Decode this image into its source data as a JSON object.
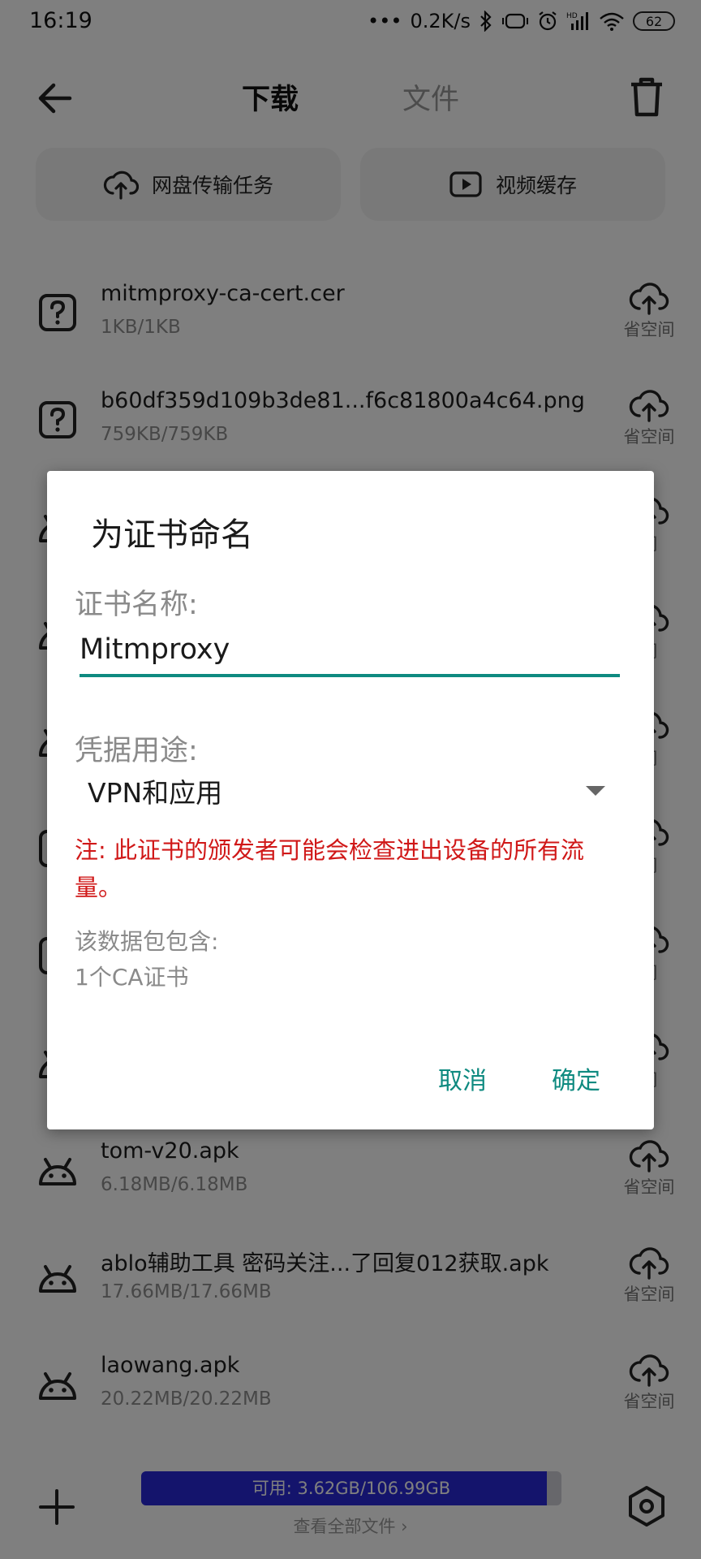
{
  "status_bar": {
    "time": "16:19",
    "net_speed": "0.2K/s",
    "battery": "62",
    "icons": [
      "dots-icon",
      "bluetooth-icon",
      "vibrate-icon",
      "alarm-icon",
      "signal-icon",
      "wifi-icon",
      "battery-icon"
    ]
  },
  "header": {
    "tabs": [
      {
        "label": "下载",
        "active": true
      },
      {
        "label": "文件",
        "active": false
      }
    ]
  },
  "cards": [
    {
      "label": "网盘传输任务",
      "icon": "cloud-transfer-icon"
    },
    {
      "label": "视频缓存",
      "icon": "video-play-icon"
    }
  ],
  "downloads": [
    {
      "name": "mitmproxy-ca-cert.cer",
      "size": "1KB/1KB",
      "icon": "unknown-file-icon",
      "action": "省空间"
    },
    {
      "name": "b60df359d109b3de81...f6c81800a4c64.png",
      "size": "759KB/759KB",
      "icon": "unknown-file-icon",
      "action": "省空间"
    },
    {
      "name": "",
      "size": "",
      "icon": "android-icon",
      "action": "间"
    },
    {
      "name": "",
      "size": "",
      "icon": "android-icon",
      "action": "间"
    },
    {
      "name": "",
      "size": "",
      "icon": "android-icon",
      "action": "间"
    },
    {
      "name": "",
      "size": "",
      "icon": "unknown-file-icon",
      "action": "间"
    },
    {
      "name": "",
      "size": "",
      "icon": "unknown-file-icon",
      "action": "间"
    },
    {
      "name": "",
      "size": "",
      "icon": "android-icon",
      "action": "间"
    },
    {
      "name": "tom-v20.apk",
      "size": "6.18MB/6.18MB",
      "icon": "android-icon",
      "action": "省空间"
    },
    {
      "name": "ablo辅助工具 密码关注...了回复012获取.apk",
      "size": "17.66MB/17.66MB",
      "icon": "android-icon",
      "action": "省空间"
    },
    {
      "name": "laowang.apk",
      "size": "20.22MB/20.22MB",
      "icon": "android-icon",
      "action": "省空间"
    }
  ],
  "bottom_bar": {
    "storage_text": "可用: 3.62GB/106.99GB",
    "storage_used_fraction": 0.966,
    "view_all": "查看全部文件 ›"
  },
  "dialog": {
    "title": "为证书命名",
    "name_label": "证书名称:",
    "name_value": "Mitmproxy",
    "usage_label": "凭据用途:",
    "usage_value": "VPN和应用",
    "warning": "注: 此证书的颁发者可能会检查进出设备的所有流量。",
    "contains_label": "该数据包包含:",
    "contains_value": "1个CA证书",
    "cancel": "取消",
    "ok": "确定"
  },
  "colors": {
    "accent": "#0e8a80",
    "warning": "#d01818",
    "storage_fill": "#2828d8"
  }
}
